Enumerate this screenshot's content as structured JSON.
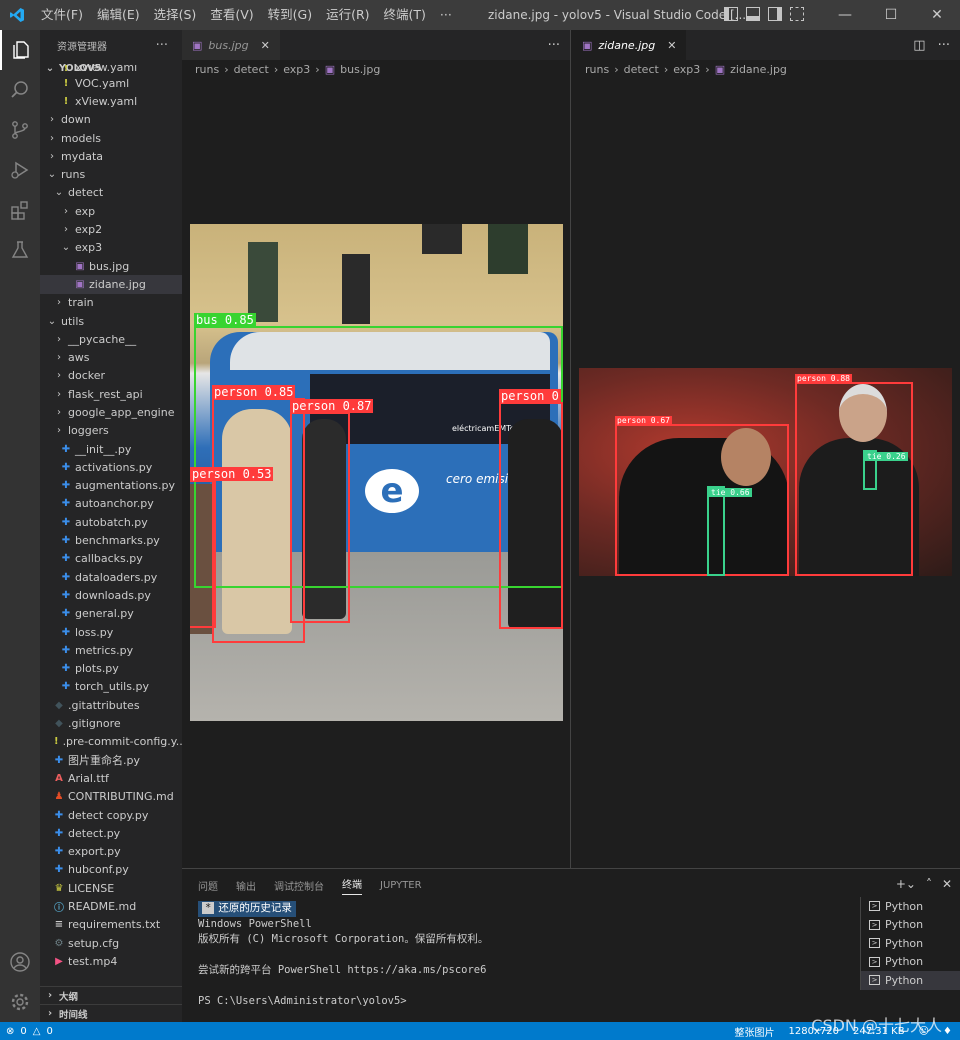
{
  "titlebar": {
    "menus": [
      "文件(F)",
      "编辑(E)",
      "选择(S)",
      "查看(V)",
      "转到(G)",
      "运行(R)",
      "终端(T)",
      "···"
    ],
    "title": "zidane.jpg - yolov5 - Visual Studio Code [..."
  },
  "sidebar": {
    "header": "资源管理器",
    "root": "YOLOV5",
    "items": [
      {
        "label": "xView.yaml",
        "indent": 2,
        "type": "yaml",
        "partial": true
      },
      {
        "label": "VOC.yaml",
        "indent": 2,
        "type": "yaml"
      },
      {
        "label": "xView.yaml",
        "indent": 2,
        "type": "yaml"
      },
      {
        "label": "down",
        "indent": 1,
        "type": "folder"
      },
      {
        "label": "models",
        "indent": 1,
        "type": "folder"
      },
      {
        "label": "mydata",
        "indent": 1,
        "type": "folder"
      },
      {
        "label": "runs",
        "indent": 1,
        "type": "folder-open"
      },
      {
        "label": "detect",
        "indent": 2,
        "type": "folder-open"
      },
      {
        "label": "exp",
        "indent": 3,
        "type": "folder"
      },
      {
        "label": "exp2",
        "indent": 3,
        "type": "folder"
      },
      {
        "label": "exp3",
        "indent": 3,
        "type": "folder-open"
      },
      {
        "label": "bus.jpg",
        "indent": 4,
        "type": "image"
      },
      {
        "label": "zidane.jpg",
        "indent": 4,
        "type": "image",
        "selected": true
      },
      {
        "label": "train",
        "indent": 2,
        "type": "folder"
      },
      {
        "label": "utils",
        "indent": 1,
        "type": "folder-open"
      },
      {
        "label": "__pycache__",
        "indent": 2,
        "type": "folder"
      },
      {
        "label": "aws",
        "indent": 2,
        "type": "folder"
      },
      {
        "label": "docker",
        "indent": 2,
        "type": "folder"
      },
      {
        "label": "flask_rest_api",
        "indent": 2,
        "type": "folder"
      },
      {
        "label": "google_app_engine",
        "indent": 2,
        "type": "folder"
      },
      {
        "label": "loggers",
        "indent": 2,
        "type": "folder"
      },
      {
        "label": "__init__.py",
        "indent": 2,
        "type": "py"
      },
      {
        "label": "activations.py",
        "indent": 2,
        "type": "py"
      },
      {
        "label": "augmentations.py",
        "indent": 2,
        "type": "py"
      },
      {
        "label": "autoanchor.py",
        "indent": 2,
        "type": "py"
      },
      {
        "label": "autobatch.py",
        "indent": 2,
        "type": "py"
      },
      {
        "label": "benchmarks.py",
        "indent": 2,
        "type": "py"
      },
      {
        "label": "callbacks.py",
        "indent": 2,
        "type": "py"
      },
      {
        "label": "dataloaders.py",
        "indent": 2,
        "type": "py"
      },
      {
        "label": "downloads.py",
        "indent": 2,
        "type": "py"
      },
      {
        "label": "general.py",
        "indent": 2,
        "type": "py"
      },
      {
        "label": "loss.py",
        "indent": 2,
        "type": "py"
      },
      {
        "label": "metrics.py",
        "indent": 2,
        "type": "py"
      },
      {
        "label": "plots.py",
        "indent": 2,
        "type": "py"
      },
      {
        "label": "torch_utils.py",
        "indent": 2,
        "type": "py"
      },
      {
        "label": ".gitattributes",
        "indent": 1,
        "type": "git"
      },
      {
        "label": ".gitignore",
        "indent": 1,
        "type": "git"
      },
      {
        "label": ".pre-commit-config.y...",
        "indent": 1,
        "type": "yaml"
      },
      {
        "label": "图片重命名.py",
        "indent": 1,
        "type": "py"
      },
      {
        "label": "Arial.ttf",
        "indent": 1,
        "type": "font"
      },
      {
        "label": "CONTRIBUTING.md",
        "indent": 1,
        "type": "contrib"
      },
      {
        "label": "detect copy.py",
        "indent": 1,
        "type": "py"
      },
      {
        "label": "detect.py",
        "indent": 1,
        "type": "py"
      },
      {
        "label": "export.py",
        "indent": 1,
        "type": "py"
      },
      {
        "label": "hubconf.py",
        "indent": 1,
        "type": "py"
      },
      {
        "label": "LICENSE",
        "indent": 1,
        "type": "license"
      },
      {
        "label": "README.md",
        "indent": 1,
        "type": "info"
      },
      {
        "label": "requirements.txt",
        "indent": 1,
        "type": "txt"
      },
      {
        "label": "setup.cfg",
        "indent": 1,
        "type": "cfg"
      },
      {
        "label": "test.mp4",
        "indent": 1,
        "type": "mp4"
      }
    ],
    "outline": "大纲",
    "timeline": "时间线"
  },
  "editor_left": {
    "tab": "bus.jpg",
    "breadcrumb": [
      "runs",
      "detect",
      "exp3",
      "bus.jpg"
    ],
    "detections": [
      {
        "label": "bus 0.85",
        "color": "green"
      },
      {
        "label": "person 0.85",
        "color": "red"
      },
      {
        "label": "person 0.87",
        "color": "red"
      },
      {
        "label": "person 0",
        "color": "red"
      },
      {
        "label": "person 0.53",
        "color": "red"
      }
    ],
    "signs": [
      "cero emisiones",
      "eléctricamEMTe"
    ]
  },
  "editor_right": {
    "tab": "zidane.jpg",
    "breadcrumb": [
      "runs",
      "detect",
      "exp3",
      "zidane.jpg"
    ],
    "detections": [
      {
        "label": "person 0.67",
        "color": "red"
      },
      {
        "label": "person 0.88",
        "color": "red"
      },
      {
        "label": "tie 0.66",
        "color": "teal"
      },
      {
        "label": "tie 0.26",
        "color": "teal"
      }
    ]
  },
  "panel": {
    "tabs": [
      "问题",
      "输出",
      "调试控制台",
      "终端",
      "JUPYTER"
    ],
    "active_tab": "终端",
    "history_label": "还原的历史记录",
    "lines": [
      "Windows PowerShell",
      "版权所有 (C) Microsoft Corporation。保留所有权利。",
      "",
      "尝试新的跨平台 PowerShell https://aka.ms/pscore6",
      "",
      "PS C:\\Users\\Administrator\\yolov5>"
    ],
    "terminals": [
      "Python",
      "Python",
      "Python",
      "Python",
      "Python"
    ]
  },
  "statusbar": {
    "errors": "0",
    "warnings": "0",
    "right": [
      "整张图片",
      "1280x720",
      "247.31 KB"
    ]
  },
  "watermark": "CSDN @十七大人",
  "colors": {
    "accent": "#007acc",
    "detect_red": "#ff3b3b",
    "detect_green": "#38d430",
    "tie_teal": "#3ad18c"
  }
}
